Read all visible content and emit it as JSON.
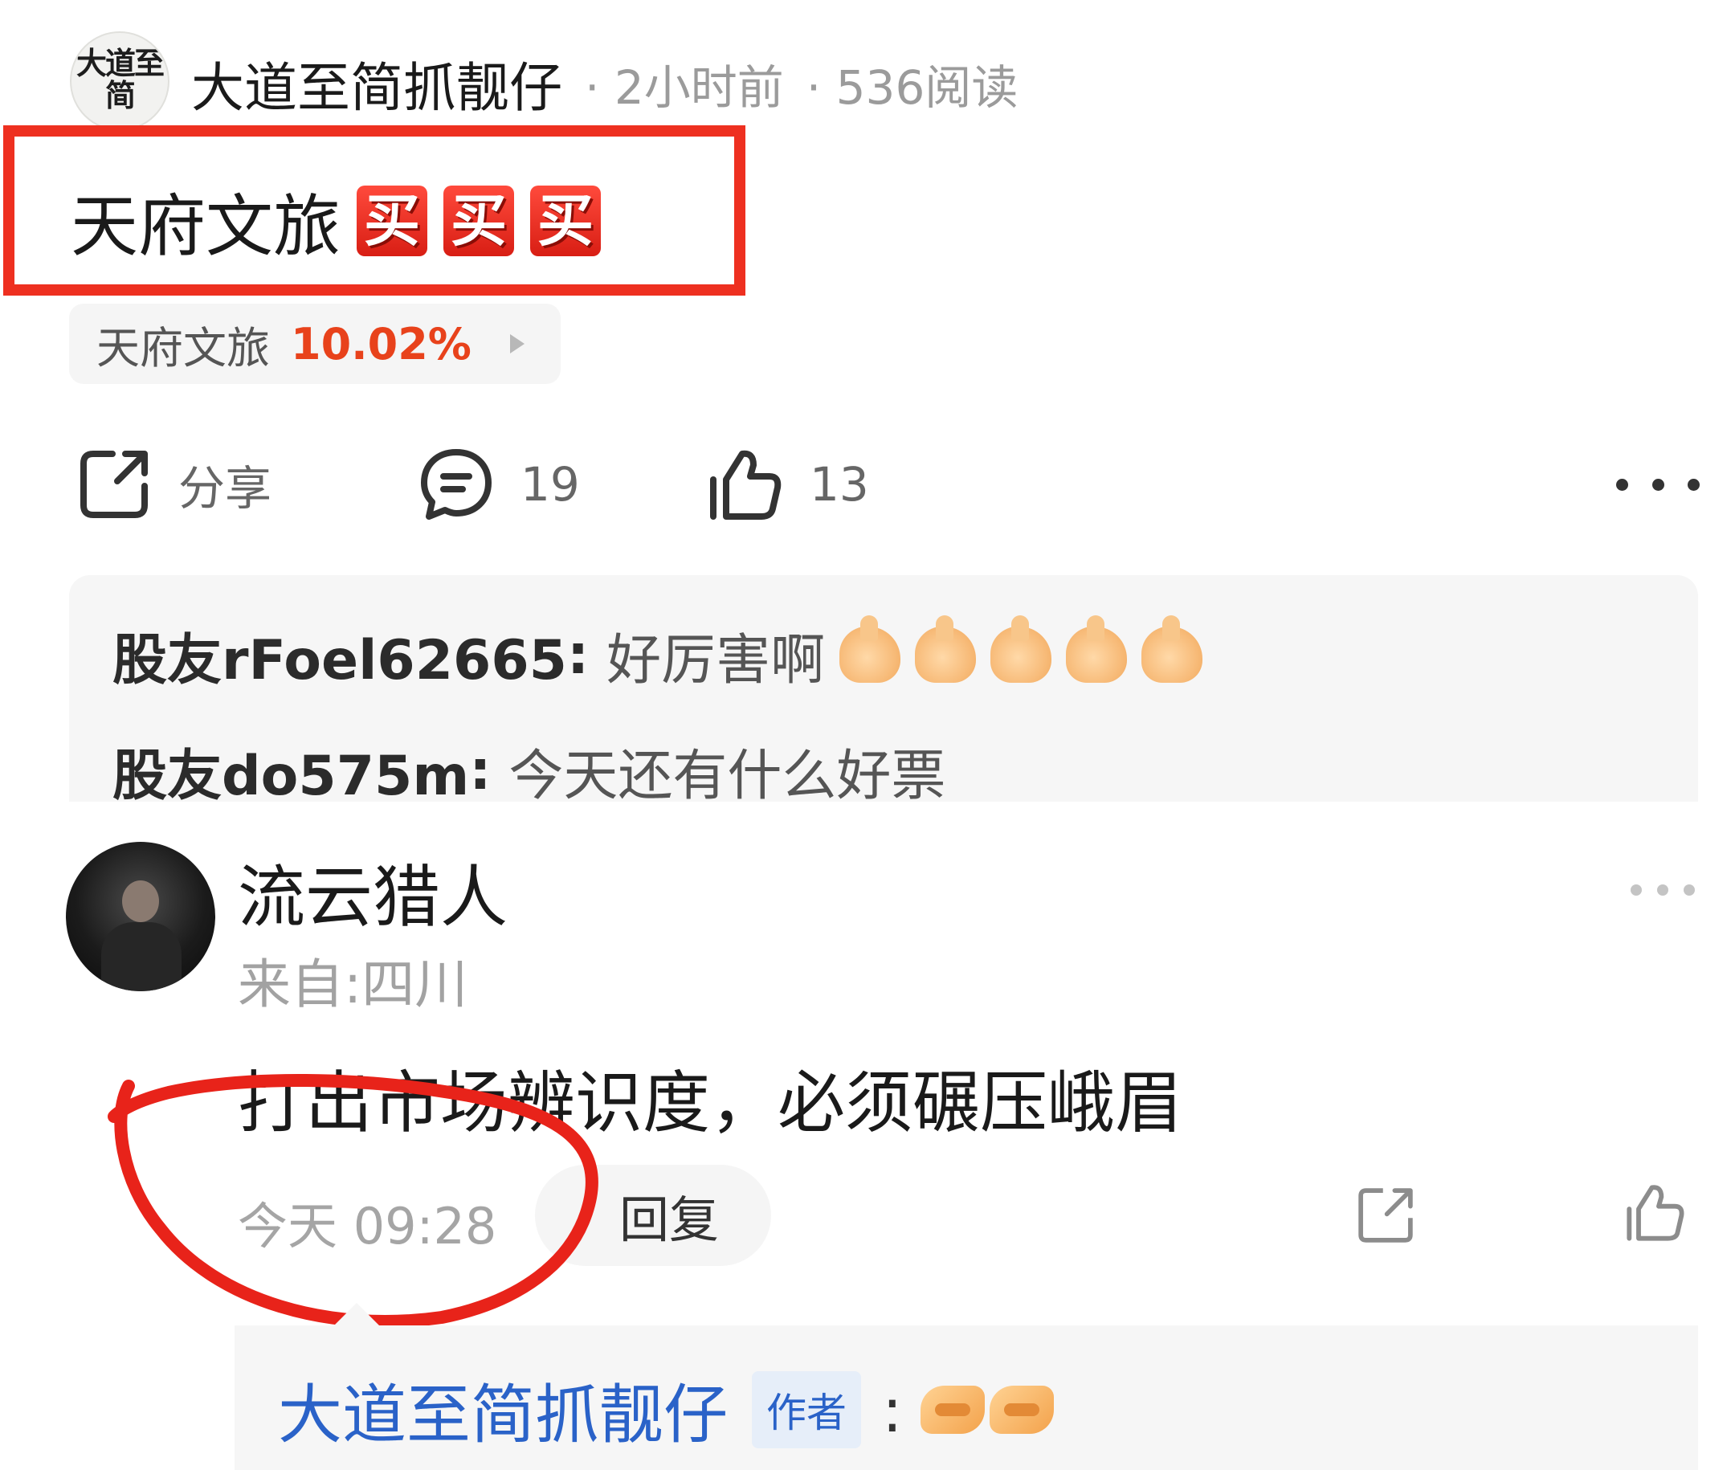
{
  "post": {
    "author": "大道至简抓靓仔",
    "avatar_text": "大道至简",
    "time": "· 2小时前",
    "reads": "· 536阅读",
    "title": "天府文旅",
    "buy_emoji": "买",
    "stock": {
      "name": "天府文旅",
      "change": "10.02%"
    }
  },
  "actions": {
    "share_label": "分享",
    "comment_count": "19",
    "like_count": "13",
    "icons": [
      "share-icon",
      "comment-icon",
      "like-icon",
      "more-icon"
    ]
  },
  "preview_comments": [
    {
      "user": "股友rFoel62665",
      "colon": ":",
      "text": "好厉害啊",
      "emoji": "thumbs-up",
      "emoji_count": 5
    },
    {
      "user": "股友do575m",
      "colon": ":",
      "text": "今天还有什么好票"
    }
  ],
  "comment": {
    "user": "流云猎人",
    "location": "来自:四川",
    "text": "打出市场辨识度，必须碾压峨眉",
    "time": "今天 09:28",
    "reply_label": "回复"
  },
  "author_reply": {
    "author": "大道至简抓靓仔",
    "badge": "作者",
    "colon": ":",
    "emoji": "handshake",
    "emoji_count": 2
  },
  "colors": {
    "highlight_red": "#ee3020",
    "stock_up": "#e8421b",
    "link_blue": "#2a62c8"
  }
}
